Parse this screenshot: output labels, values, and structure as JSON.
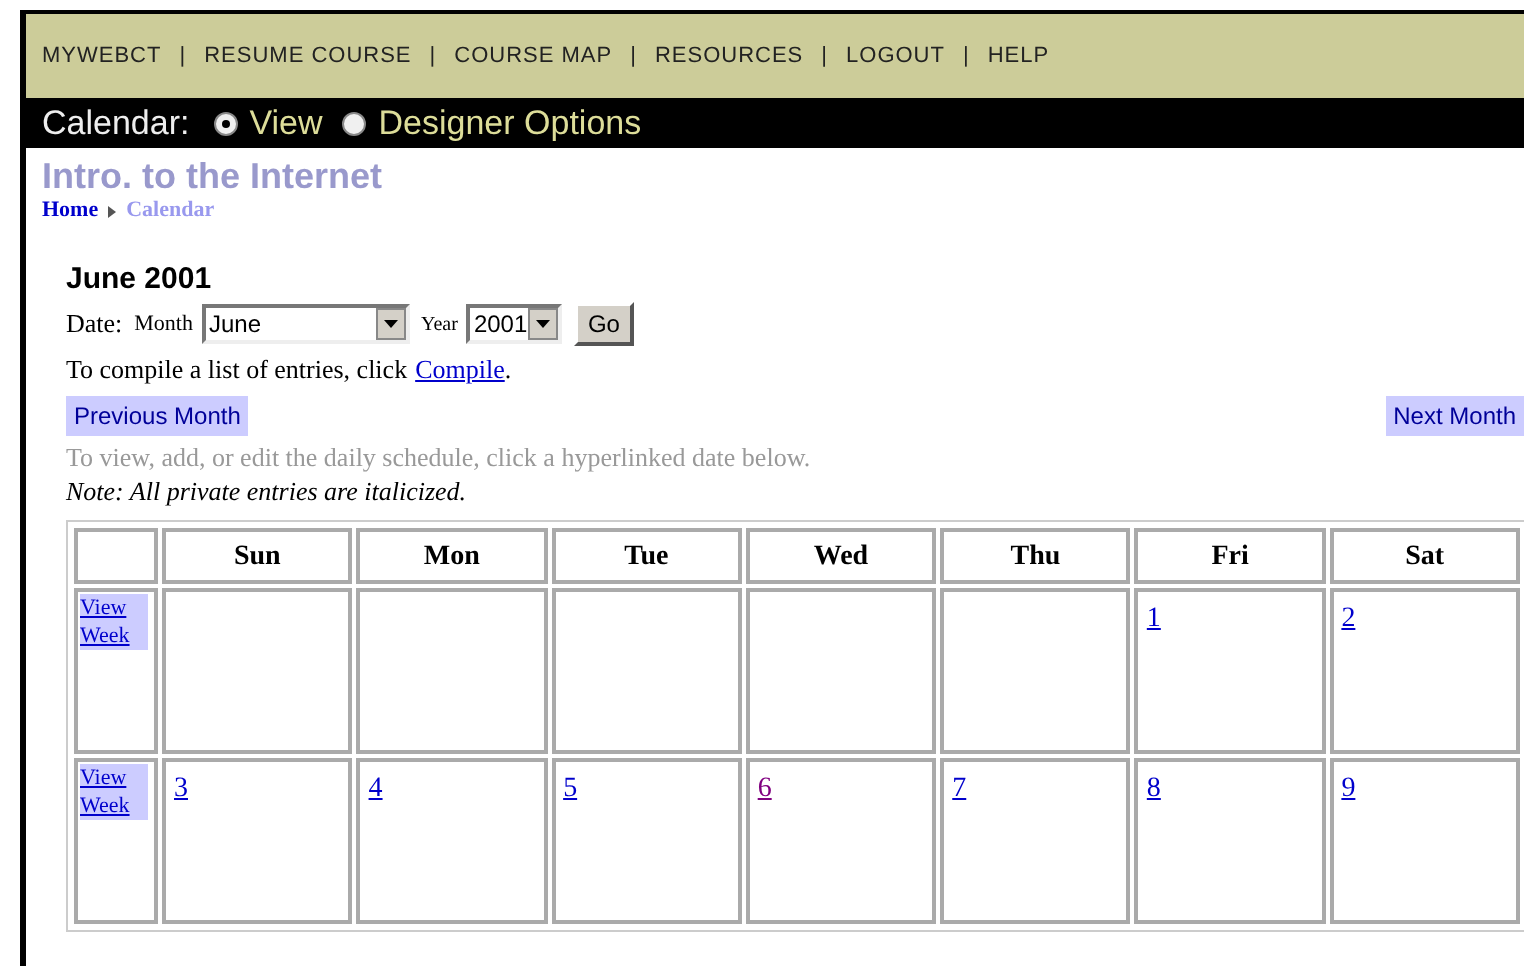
{
  "nav": [
    {
      "kind": "link",
      "label": "MYWEBCT"
    },
    {
      "kind": "separator",
      "label": "|"
    },
    {
      "kind": "link",
      "label": "RESUME COURSE"
    },
    {
      "kind": "separator",
      "label": "|"
    },
    {
      "kind": "link",
      "label": "COURSE MAP"
    },
    {
      "kind": "separator",
      "label": "|"
    },
    {
      "kind": "link",
      "label": "RESOURCES"
    },
    {
      "kind": "separator",
      "label": "|"
    },
    {
      "kind": "link",
      "label": "LOGOUT"
    },
    {
      "kind": "separator",
      "label": "|"
    },
    {
      "kind": "link",
      "label": "HELP"
    }
  ],
  "mode_bar": {
    "label": "Calendar:",
    "options": [
      {
        "label": "View",
        "selected": true
      },
      {
        "label": "Designer Options",
        "selected": false
      }
    ]
  },
  "course_title": "Intro. to the Internet",
  "breadcrumb": [
    {
      "label": "Home",
      "current": false
    },
    {
      "label": "Calendar",
      "current": true
    }
  ],
  "heading": "June 2001",
  "date_form": {
    "label": "Date:",
    "month_label": "Month",
    "month": "June",
    "year_label": "Year",
    "year": "2001",
    "go": "Go"
  },
  "compile_text": "To compile a list of entries, click",
  "compile_link": "Compile",
  "compile_end": ".",
  "previous_month": "Previous Month",
  "next_month": "Next Month",
  "hint": "To view, add, or edit the daily schedule, click a hyperlinked date below.",
  "note": "*Note:* All private entries are italicized.",
  "calendar": {
    "columns": [
      "Sun",
      "Mon",
      "Tue",
      "Wed",
      "Thu",
      "Fri",
      "Sat"
    ],
    "weeks": [
      {
        "link": "View Week",
        "days": [
          {
            "kind": "blank"
          },
          {
            "kind": "blank"
          },
          {
            "kind": "blank"
          },
          {
            "kind": "blank"
          },
          {
            "kind": "blank"
          },
          {
            "date": "1",
            "visited": false
          },
          {
            "date": "2",
            "visited": false
          }
        ]
      },
      {
        "link": "View Week",
        "days": [
          {
            "date": "3",
            "visited": false
          },
          {
            "date": "4",
            "visited": false
          },
          {
            "date": "5",
            "visited": false
          },
          {
            "date": "6",
            "visited": true
          },
          {
            "date": "7",
            "visited": false
          },
          {
            "date": "8",
            "visited": false
          },
          {
            "date": "9",
            "visited": false
          }
        ]
      }
    ]
  }
}
